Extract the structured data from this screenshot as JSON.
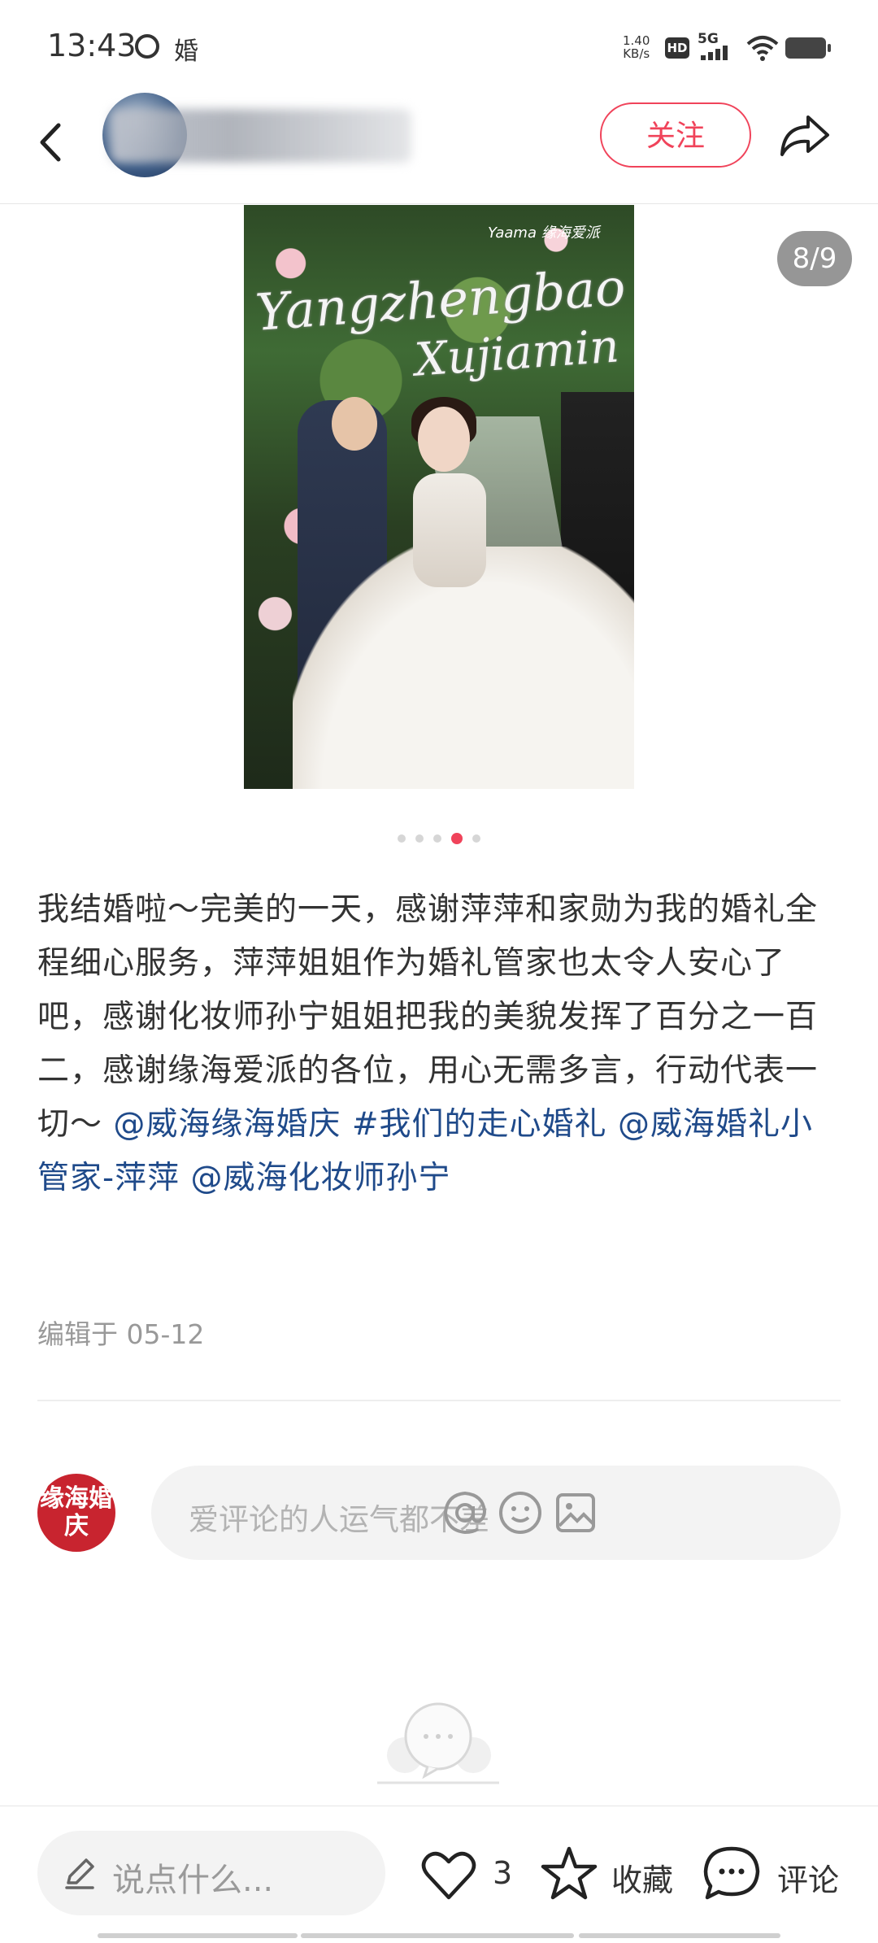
{
  "status_bar": {
    "time": "13:43",
    "app_char": "婚",
    "net_speed_value": "1.40",
    "net_speed_unit": "KB/s",
    "hd": "HD",
    "network": "5G"
  },
  "header": {
    "follow_label": "关注"
  },
  "photo": {
    "script_line1": "Yangzhengbao",
    "script_line2": "Xujiamin",
    "logo_text": "Yaama 缘海爱派",
    "counter": "8/9",
    "current_index": 4,
    "total_dots": 5
  },
  "post": {
    "text_plain": "我结婚啦～完美的一天，感谢萍萍和家勋为我的婚礼全程细心服务，萍萍姐姐作为婚礼管家也太令人安心了吧，感谢化妆师孙宁姐姐把我的美貌发挥了百分之一百二，感谢缘海爱派的各位，用心无需多言，行动代表一切～",
    "mention1": "@威海缘海婚庆",
    "hashtag": "#我们的走心婚礼",
    "mention2": "@威海婚礼小管家-萍萍",
    "mention3": "@威海化妆师孙宁",
    "edit_time": "编辑于 05-12"
  },
  "comment": {
    "avatar_text": "缘海婚庆",
    "placeholder": "爱评论的人运气都不差"
  },
  "bottom_bar": {
    "say_placeholder": "说点什么...",
    "like_count": "3",
    "collect_label": "收藏",
    "comment_label": "评论"
  },
  "colors": {
    "accent": "#f0435a",
    "link": "#1f4a8a",
    "brand_avatar": "#c8242f"
  }
}
